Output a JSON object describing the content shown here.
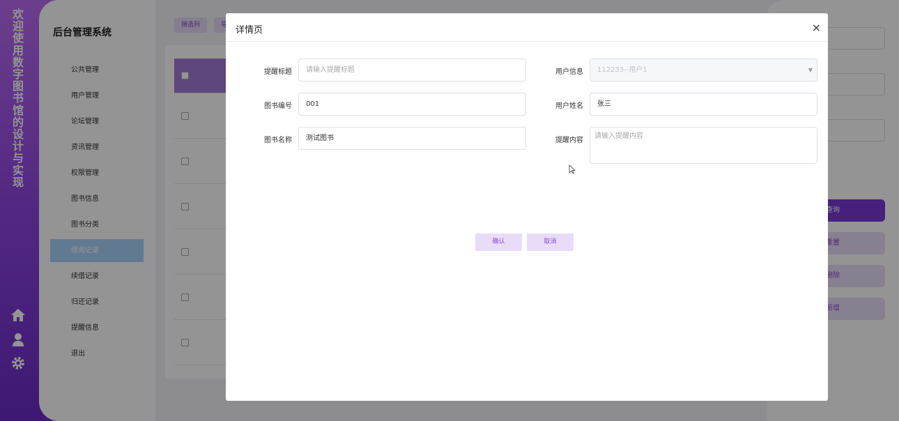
{
  "rail": {
    "title_chars": [
      "欢",
      "迎",
      "使",
      "用",
      "数",
      "字",
      "图",
      "书",
      "馆",
      "的",
      "设",
      "计",
      "与",
      "实",
      "现"
    ],
    "icons": [
      "home-icon",
      "user-icon",
      "gear-icon"
    ]
  },
  "sidebar": {
    "brand": "后台管理系统",
    "items": [
      {
        "label": "公共管理"
      },
      {
        "label": "用户管理"
      },
      {
        "label": "论坛管理"
      },
      {
        "label": "资讯管理"
      },
      {
        "label": "权限管理"
      },
      {
        "label": "图书信息"
      },
      {
        "label": "图书分类"
      },
      {
        "label": "借阅记录",
        "active": true
      },
      {
        "label": "续借记录"
      },
      {
        "label": "归还记录"
      },
      {
        "label": "提醒信息"
      },
      {
        "label": "退出"
      }
    ]
  },
  "background": {
    "filter_btn": "筛选列",
    "export_btn": "导",
    "search_btn": "查询",
    "reset_btn": "重置",
    "delete_btn": "删除",
    "add_btn": "新增"
  },
  "modal": {
    "title": "详情页",
    "close": "×",
    "fields": {
      "remind_title_label": "提醒标题",
      "remind_title_placeholder": "请输入提醒标题",
      "book_no_label": "图书编号",
      "book_no_value": "001",
      "book_name_label": "图书名称",
      "book_name_value": "测试图书",
      "user_info_label": "用户信息",
      "user_info_value": "112233--用户1",
      "user_name_label": "用户姓名",
      "user_name_value": "张三",
      "remind_content_label": "提醒内容",
      "remind_content_placeholder": "请输入提醒内容"
    },
    "confirm": "确认",
    "cancel": "取消"
  },
  "colors": {
    "accent": "#8a4bd6",
    "active_menu": "#a7d2fb"
  }
}
